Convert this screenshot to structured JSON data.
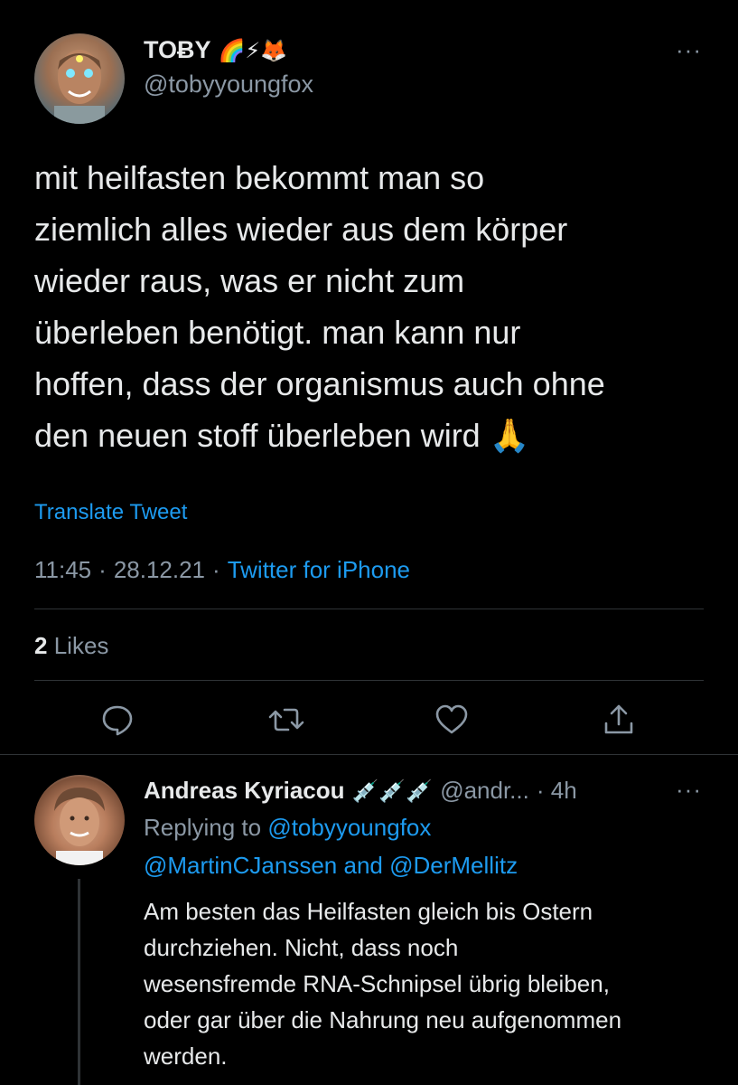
{
  "tweet": {
    "author": {
      "name": "TOɃY",
      "name_emojis": "🌈⚡🦊",
      "handle": "@tobyyoungfox"
    },
    "more_label": "···",
    "text": "mit heilfasten bekommt man so\nziemlich alles wieder aus dem körper\nwieder raus, was er nicht zum\nüberleben benötigt. man kann nur\nhoffen, dass der organismus auch ohne\nden neuen stoff überleben wird 🙏",
    "translate_label": "Translate Tweet",
    "time": "11:45",
    "date": "28.12.21",
    "separator": "·",
    "source": "Twitter for iPhone",
    "likes_count": "2",
    "likes_label": "Likes",
    "actions": [
      "reply-icon",
      "retweet-icon",
      "like-icon",
      "share-icon"
    ]
  },
  "reply": {
    "author": {
      "name": "Andreas Kyriacou",
      "name_emojis": "💉💉💉",
      "handle": "@andr...",
      "time": "· 4h"
    },
    "more_label": "···",
    "replying_to_prefix": "Replying to",
    "replying_to_user1": "@tobyyoungfox",
    "replying_to_user2": "@MartinCJanssen",
    "replying_to_and": "and",
    "replying_to_user3": "@DerMellitz",
    "text": "Am besten das Heilfasten gleich bis Ostern\ndurchziehen. Nicht, dass noch\nwesensfremde RNA-Schnipsel übrig bleiben,\noder gar über die Nahrung neu aufgenommen\nwerden."
  },
  "colors": {
    "background": "#000000",
    "text": "#e7e9ea",
    "secondary": "#8b98a5",
    "link": "#1d9bf0",
    "divider": "#2f3336"
  }
}
